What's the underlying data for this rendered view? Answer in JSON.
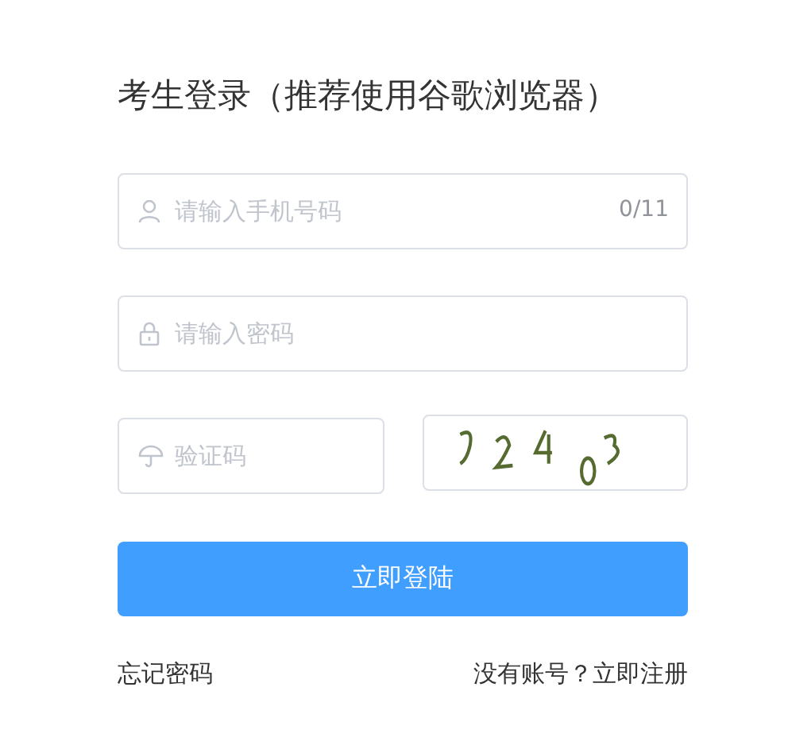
{
  "title": "考生登录（推荐使用谷歌浏览器）",
  "phone": {
    "placeholder": "请输入手机号码",
    "count": "0/11"
  },
  "password": {
    "placeholder": "请输入密码"
  },
  "captcha": {
    "placeholder": "验证码"
  },
  "login_button": "立即登陆",
  "forgot_link": "忘记密码",
  "register_prompt": "没有账号？",
  "register_link": "立即注册"
}
